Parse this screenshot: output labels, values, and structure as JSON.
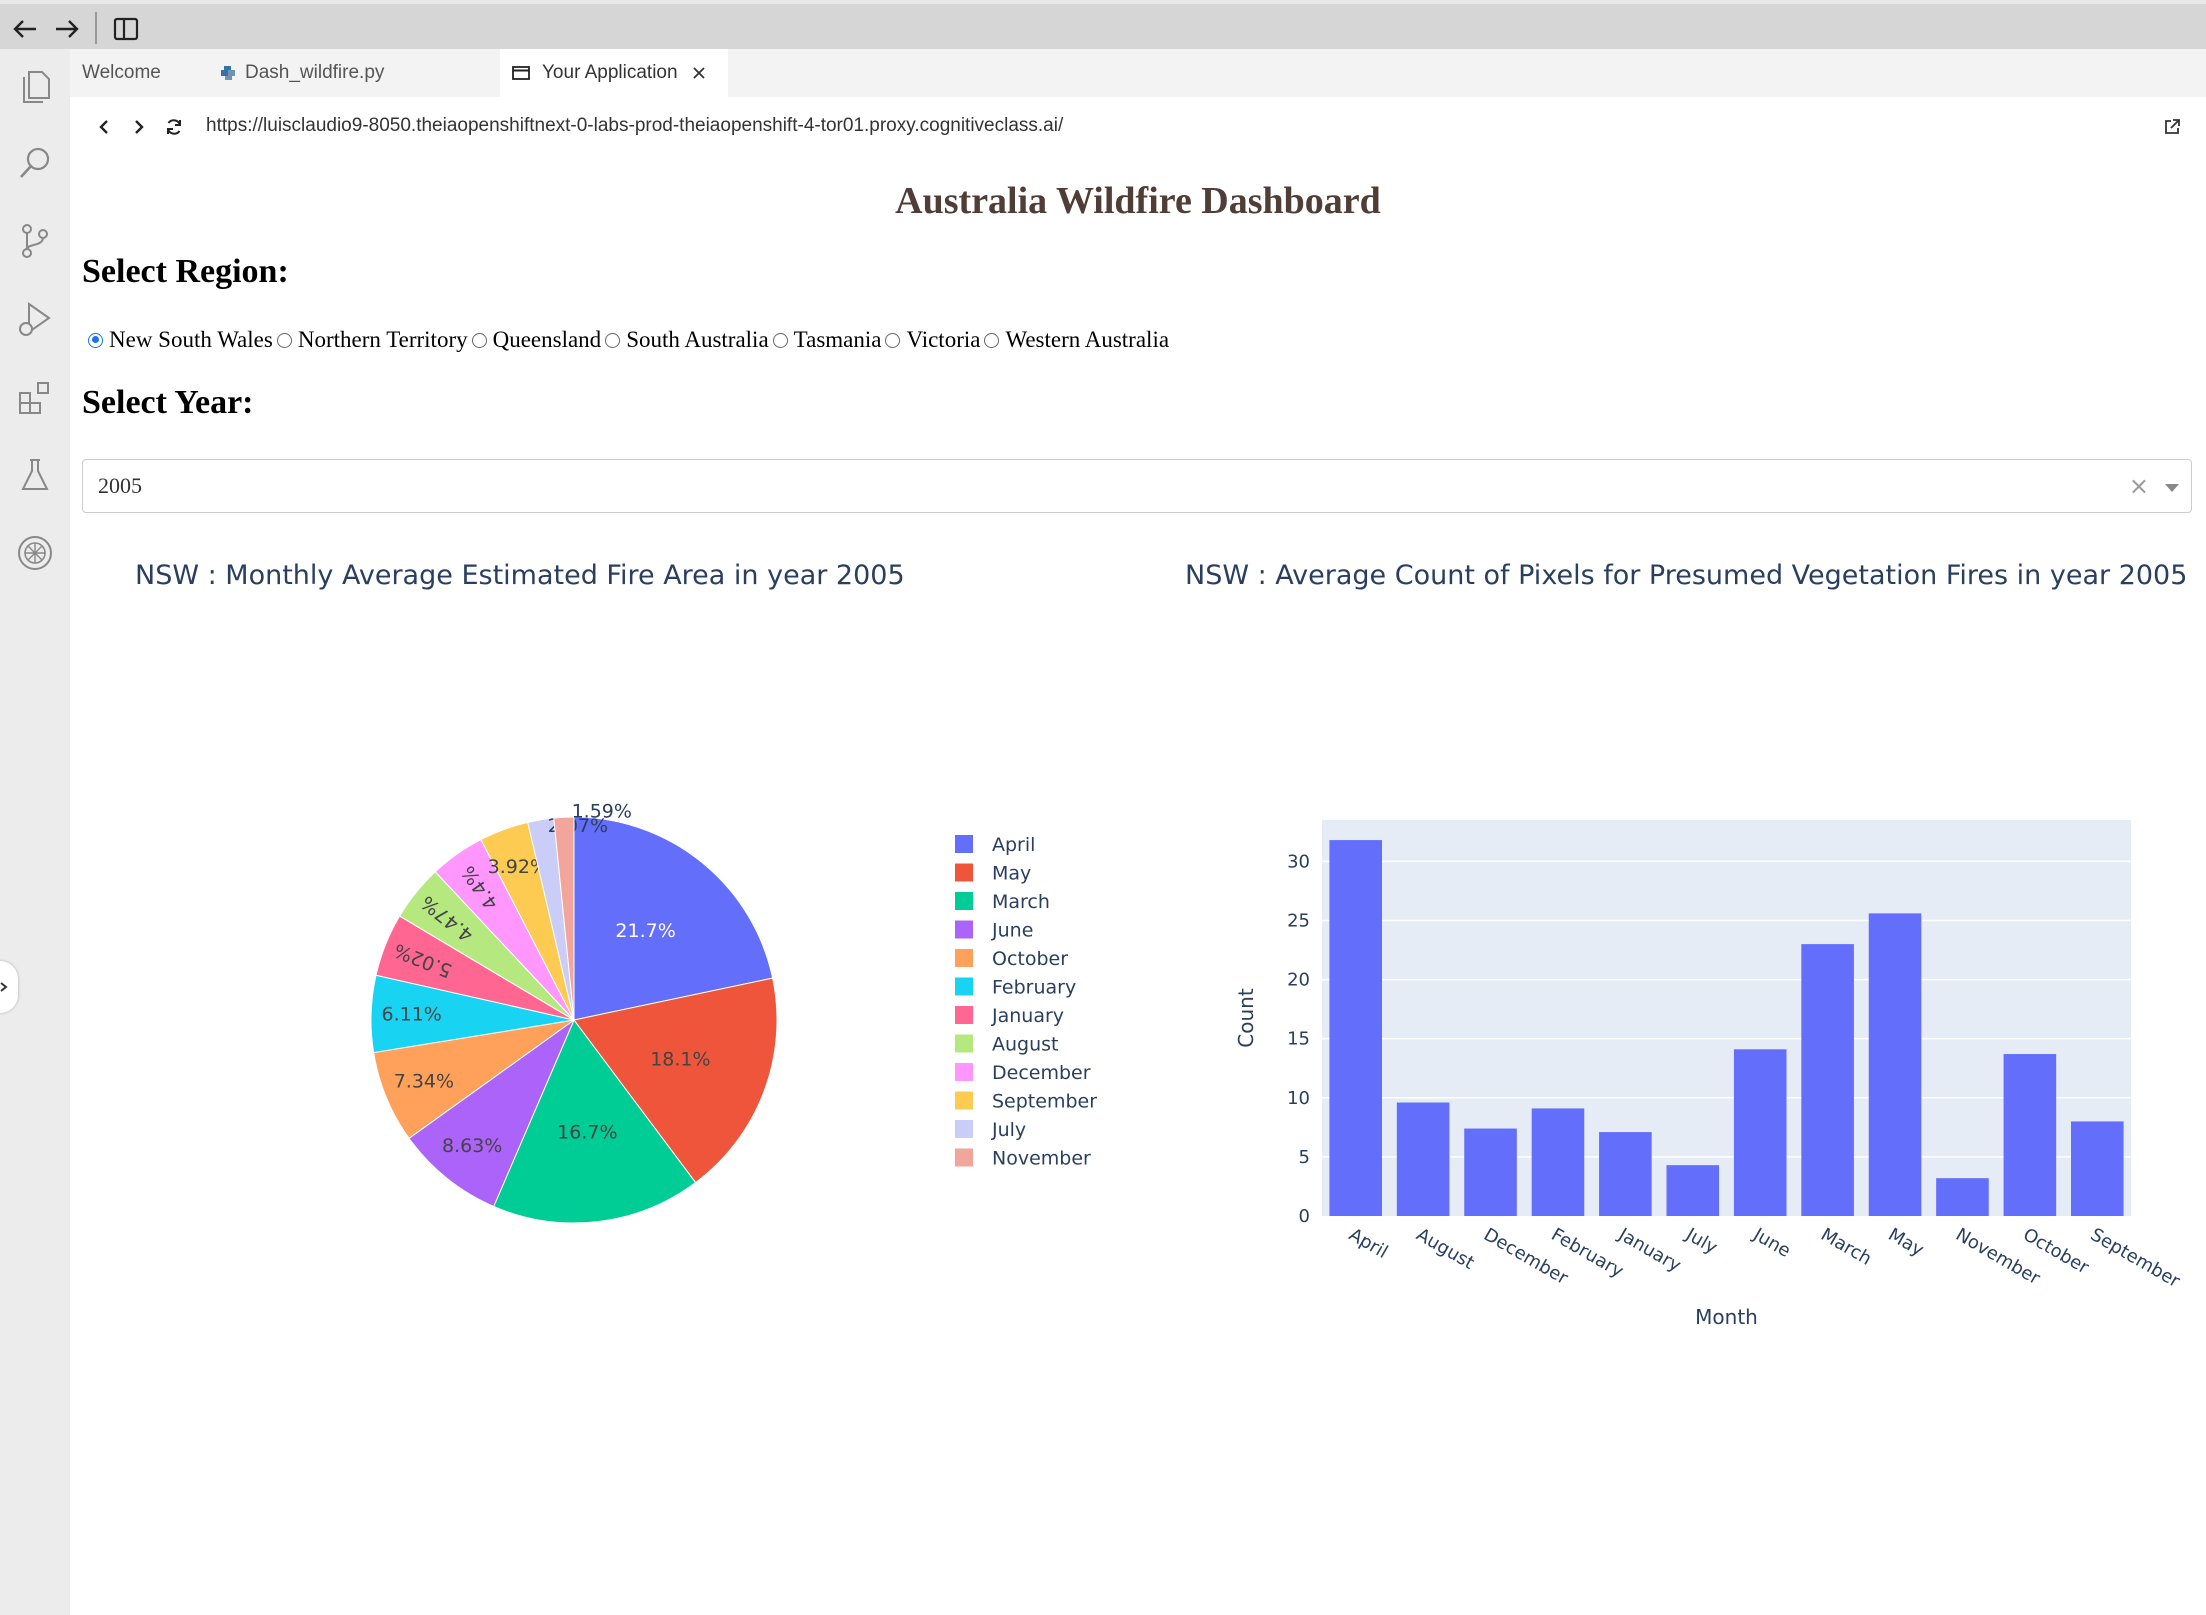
{
  "browser": {
    "tabs": [
      {
        "label": "Welcome"
      },
      {
        "label": "Dash_wildfire.py"
      },
      {
        "label": "Your Application"
      }
    ],
    "url": "https://luisclaudio9-8050.theiaopenshiftnext-0-labs-prod-theiaopenshift-4-tor01.proxy.cognitiveclass.ai/"
  },
  "app": {
    "title": "Australia Wildfire Dashboard",
    "region_heading": "Select Region:",
    "regions": [
      "New South Wales",
      "Northern Territory",
      "Queensland",
      "South Australia",
      "Tasmania",
      "Victoria",
      "Western Australia"
    ],
    "selected_region": "New South Wales",
    "year_heading": "Select Year:",
    "year_value": "2005",
    "clear_symbol": "×"
  },
  "colors": {
    "title": "#503D36",
    "bar": "#636efa",
    "plot_bg": "#e5ecf6",
    "axis_text": "#2a3f5f"
  },
  "chart_data": [
    {
      "type": "pie",
      "title": "NSW : Monthly Average Estimated Fire Area in year 2005",
      "labels": [
        "April",
        "May",
        "March",
        "June",
        "October",
        "February",
        "January",
        "August",
        "December",
        "September",
        "July",
        "November"
      ],
      "values": [
        21.7,
        18.1,
        16.7,
        8.63,
        7.34,
        6.11,
        5.02,
        4.47,
        4.4,
        3.92,
        2.07,
        1.59
      ],
      "value_labels": [
        "21.7%",
        "18.1%",
        "16.7%",
        "8.63%",
        "7.34%",
        "6.11%",
        "5.02%",
        "4.47%",
        "4.4%",
        "3.92%",
        "2.07%",
        "1.59%"
      ],
      "colors": [
        "#636efa",
        "#EF553B",
        "#00cc96",
        "#ab63fa",
        "#FFA15A",
        "#19d3f3",
        "#FF6692",
        "#B6E880",
        "#FF97FF",
        "#FECB52",
        "#c9cdf7",
        "#f2a59b"
      ],
      "legend_position": "right"
    },
    {
      "type": "bar",
      "title": "NSW : Average Count of Pixels for Presumed Vegetation Fires in year 2005",
      "xlabel": "Month",
      "ylabel": "Count",
      "categories": [
        "April",
        "August",
        "December",
        "February",
        "January",
        "July",
        "June",
        "March",
        "May",
        "November",
        "October",
        "September"
      ],
      "values": [
        31.8,
        9.6,
        7.4,
        9.1,
        7.1,
        4.3,
        14.1,
        23.0,
        25.6,
        3.2,
        13.7,
        8.0
      ],
      "ylim": [
        0,
        33.5
      ],
      "yticks": [
        0,
        5,
        10,
        15,
        20,
        25,
        30
      ],
      "grid": true
    }
  ]
}
